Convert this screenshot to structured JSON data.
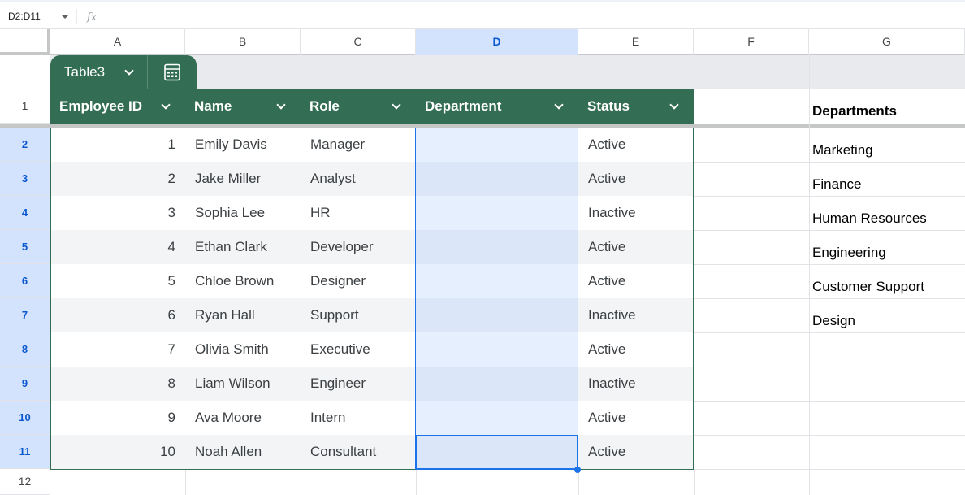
{
  "formula_bar": {
    "name_box": "D2:D11",
    "fx_label": "fx"
  },
  "columns": [
    "A",
    "B",
    "C",
    "D",
    "E",
    "F",
    "G"
  ],
  "selected_column": "D",
  "rows": [
    "1",
    "2",
    "3",
    "4",
    "5",
    "6",
    "7",
    "8",
    "9",
    "10",
    "11",
    "12"
  ],
  "table": {
    "name": "Table3",
    "headers": [
      "Employee ID",
      "Name",
      "Role",
      "Department",
      "Status"
    ],
    "rows": [
      {
        "id": "1",
        "name": "Emily Davis",
        "role": "Manager",
        "department": "",
        "status": "Active"
      },
      {
        "id": "2",
        "name": "Jake Miller",
        "role": "Analyst",
        "department": "",
        "status": "Active"
      },
      {
        "id": "3",
        "name": "Sophia Lee",
        "role": "HR",
        "department": "",
        "status": "Inactive"
      },
      {
        "id": "4",
        "name": "Ethan Clark",
        "role": "Developer",
        "department": "",
        "status": "Active"
      },
      {
        "id": "5",
        "name": "Chloe Brown",
        "role": "Designer",
        "department": "",
        "status": "Active"
      },
      {
        "id": "6",
        "name": "Ryan Hall",
        "role": "Support",
        "department": "",
        "status": "Inactive"
      },
      {
        "id": "7",
        "name": "Olivia Smith",
        "role": "Executive",
        "department": "",
        "status": "Active"
      },
      {
        "id": "8",
        "name": "Liam Wilson",
        "role": "Engineer",
        "department": "",
        "status": "Inactive"
      },
      {
        "id": "9",
        "name": "Ava Moore",
        "role": "Intern",
        "department": "",
        "status": "Active"
      },
      {
        "id": "10",
        "name": "Noah Allen",
        "role": "Consultant",
        "department": "",
        "status": "Active"
      }
    ]
  },
  "departments_list": {
    "header": "Departments",
    "items": [
      "Marketing",
      "Finance",
      "Human Resources",
      "Engineering",
      "Customer Support",
      "Design"
    ]
  },
  "colors": {
    "table_header": "#336d54",
    "selection": "#1a73e8",
    "selected_header_bg": "#d3e3fd"
  },
  "icons": [
    "dropdown-caret-icon",
    "fx-icon",
    "chevron-down-icon",
    "table-calculator-icon"
  ]
}
